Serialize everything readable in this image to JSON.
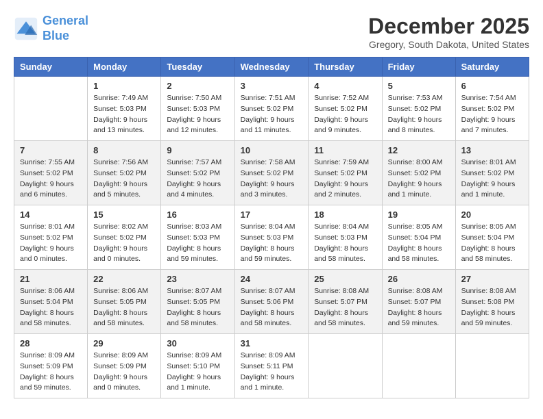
{
  "logo": {
    "line1": "General",
    "line2": "Blue"
  },
  "title": "December 2025",
  "location": "Gregory, South Dakota, United States",
  "days_of_week": [
    "Sunday",
    "Monday",
    "Tuesday",
    "Wednesday",
    "Thursday",
    "Friday",
    "Saturday"
  ],
  "weeks": [
    [
      {
        "day": "",
        "sunrise": "",
        "sunset": "",
        "daylight": ""
      },
      {
        "day": "1",
        "sunrise": "Sunrise: 7:49 AM",
        "sunset": "Sunset: 5:03 PM",
        "daylight": "Daylight: 9 hours and 13 minutes."
      },
      {
        "day": "2",
        "sunrise": "Sunrise: 7:50 AM",
        "sunset": "Sunset: 5:03 PM",
        "daylight": "Daylight: 9 hours and 12 minutes."
      },
      {
        "day": "3",
        "sunrise": "Sunrise: 7:51 AM",
        "sunset": "Sunset: 5:02 PM",
        "daylight": "Daylight: 9 hours and 11 minutes."
      },
      {
        "day": "4",
        "sunrise": "Sunrise: 7:52 AM",
        "sunset": "Sunset: 5:02 PM",
        "daylight": "Daylight: 9 hours and 9 minutes."
      },
      {
        "day": "5",
        "sunrise": "Sunrise: 7:53 AM",
        "sunset": "Sunset: 5:02 PM",
        "daylight": "Daylight: 9 hours and 8 minutes."
      },
      {
        "day": "6",
        "sunrise": "Sunrise: 7:54 AM",
        "sunset": "Sunset: 5:02 PM",
        "daylight": "Daylight: 9 hours and 7 minutes."
      }
    ],
    [
      {
        "day": "7",
        "sunrise": "Sunrise: 7:55 AM",
        "sunset": "Sunset: 5:02 PM",
        "daylight": "Daylight: 9 hours and 6 minutes."
      },
      {
        "day": "8",
        "sunrise": "Sunrise: 7:56 AM",
        "sunset": "Sunset: 5:02 PM",
        "daylight": "Daylight: 9 hours and 5 minutes."
      },
      {
        "day": "9",
        "sunrise": "Sunrise: 7:57 AM",
        "sunset": "Sunset: 5:02 PM",
        "daylight": "Daylight: 9 hours and 4 minutes."
      },
      {
        "day": "10",
        "sunrise": "Sunrise: 7:58 AM",
        "sunset": "Sunset: 5:02 PM",
        "daylight": "Daylight: 9 hours and 3 minutes."
      },
      {
        "day": "11",
        "sunrise": "Sunrise: 7:59 AM",
        "sunset": "Sunset: 5:02 PM",
        "daylight": "Daylight: 9 hours and 2 minutes."
      },
      {
        "day": "12",
        "sunrise": "Sunrise: 8:00 AM",
        "sunset": "Sunset: 5:02 PM",
        "daylight": "Daylight: 9 hours and 1 minute."
      },
      {
        "day": "13",
        "sunrise": "Sunrise: 8:01 AM",
        "sunset": "Sunset: 5:02 PM",
        "daylight": "Daylight: 9 hours and 1 minute."
      }
    ],
    [
      {
        "day": "14",
        "sunrise": "Sunrise: 8:01 AM",
        "sunset": "Sunset: 5:02 PM",
        "daylight": "Daylight: 9 hours and 0 minutes."
      },
      {
        "day": "15",
        "sunrise": "Sunrise: 8:02 AM",
        "sunset": "Sunset: 5:02 PM",
        "daylight": "Daylight: 9 hours and 0 minutes."
      },
      {
        "day": "16",
        "sunrise": "Sunrise: 8:03 AM",
        "sunset": "Sunset: 5:03 PM",
        "daylight": "Daylight: 8 hours and 59 minutes."
      },
      {
        "day": "17",
        "sunrise": "Sunrise: 8:04 AM",
        "sunset": "Sunset: 5:03 PM",
        "daylight": "Daylight: 8 hours and 59 minutes."
      },
      {
        "day": "18",
        "sunrise": "Sunrise: 8:04 AM",
        "sunset": "Sunset: 5:03 PM",
        "daylight": "Daylight: 8 hours and 58 minutes."
      },
      {
        "day": "19",
        "sunrise": "Sunrise: 8:05 AM",
        "sunset": "Sunset: 5:04 PM",
        "daylight": "Daylight: 8 hours and 58 minutes."
      },
      {
        "day": "20",
        "sunrise": "Sunrise: 8:05 AM",
        "sunset": "Sunset: 5:04 PM",
        "daylight": "Daylight: 8 hours and 58 minutes."
      }
    ],
    [
      {
        "day": "21",
        "sunrise": "Sunrise: 8:06 AM",
        "sunset": "Sunset: 5:04 PM",
        "daylight": "Daylight: 8 hours and 58 minutes."
      },
      {
        "day": "22",
        "sunrise": "Sunrise: 8:06 AM",
        "sunset": "Sunset: 5:05 PM",
        "daylight": "Daylight: 8 hours and 58 minutes."
      },
      {
        "day": "23",
        "sunrise": "Sunrise: 8:07 AM",
        "sunset": "Sunset: 5:05 PM",
        "daylight": "Daylight: 8 hours and 58 minutes."
      },
      {
        "day": "24",
        "sunrise": "Sunrise: 8:07 AM",
        "sunset": "Sunset: 5:06 PM",
        "daylight": "Daylight: 8 hours and 58 minutes."
      },
      {
        "day": "25",
        "sunrise": "Sunrise: 8:08 AM",
        "sunset": "Sunset: 5:07 PM",
        "daylight": "Daylight: 8 hours and 58 minutes."
      },
      {
        "day": "26",
        "sunrise": "Sunrise: 8:08 AM",
        "sunset": "Sunset: 5:07 PM",
        "daylight": "Daylight: 8 hours and 59 minutes."
      },
      {
        "day": "27",
        "sunrise": "Sunrise: 8:08 AM",
        "sunset": "Sunset: 5:08 PM",
        "daylight": "Daylight: 8 hours and 59 minutes."
      }
    ],
    [
      {
        "day": "28",
        "sunrise": "Sunrise: 8:09 AM",
        "sunset": "Sunset: 5:09 PM",
        "daylight": "Daylight: 8 hours and 59 minutes."
      },
      {
        "day": "29",
        "sunrise": "Sunrise: 8:09 AM",
        "sunset": "Sunset: 5:09 PM",
        "daylight": "Daylight: 9 hours and 0 minutes."
      },
      {
        "day": "30",
        "sunrise": "Sunrise: 8:09 AM",
        "sunset": "Sunset: 5:10 PM",
        "daylight": "Daylight: 9 hours and 1 minute."
      },
      {
        "day": "31",
        "sunrise": "Sunrise: 8:09 AM",
        "sunset": "Sunset: 5:11 PM",
        "daylight": "Daylight: 9 hours and 1 minute."
      },
      {
        "day": "",
        "sunrise": "",
        "sunset": "",
        "daylight": ""
      },
      {
        "day": "",
        "sunrise": "",
        "sunset": "",
        "daylight": ""
      },
      {
        "day": "",
        "sunrise": "",
        "sunset": "",
        "daylight": ""
      }
    ]
  ]
}
